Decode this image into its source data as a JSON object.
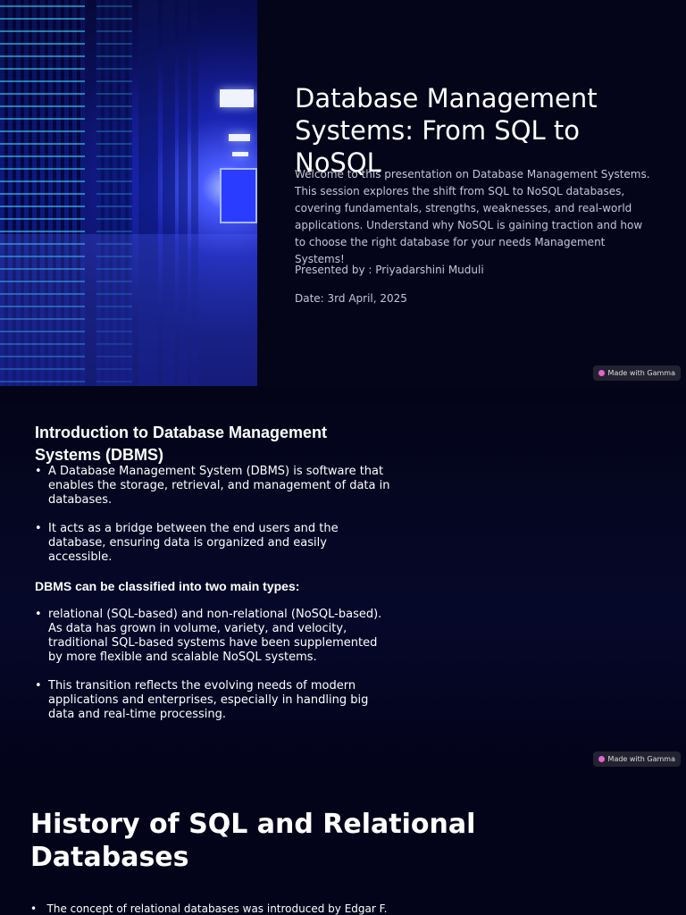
{
  "slide1": {
    "title": "Database Management Systems: From SQL to NoSQL",
    "description": "Welcome to this presentation on Database Management Systems. This session explores the shift from SQL to NoSQL databases, covering fundamentals, strengths, weaknesses, and real-world applications. Understand why NoSQL is gaining traction and how to choose the right database for your needs Management Systems!",
    "presenter": "Presented by : Priyadarshini Muduli",
    "date": "Date: 3rd April, 2025",
    "badge": "Made with Gamma"
  },
  "slide2": {
    "title": "Introduction to Database Management Systems (DBMS)",
    "bullets1": [
      " A Database Management System (DBMS) is software that enables the storage, retrieval, and management of data in databases.",
      " It acts as a bridge between the end users and the database, ensuring data is organized and easily accessible."
    ],
    "subheading": "DBMS can be classified into two main types:",
    "bullets2": [
      "relational (SQL-based) and non-relational (NoSQL-based). As data has grown in volume, variety, and velocity, traditional SQL-based systems have been supplemented by more flexible and scalable NoSQL systems.",
      "This transition reflects the evolving needs of modern applications and enterprises, especially in handling big data and real-time processing."
    ],
    "badge": "Made with Gamma"
  },
  "slide3": {
    "title": "History of SQL and Relational Databases",
    "bullet": "The concept of relational databases was introduced by Edgar F."
  }
}
